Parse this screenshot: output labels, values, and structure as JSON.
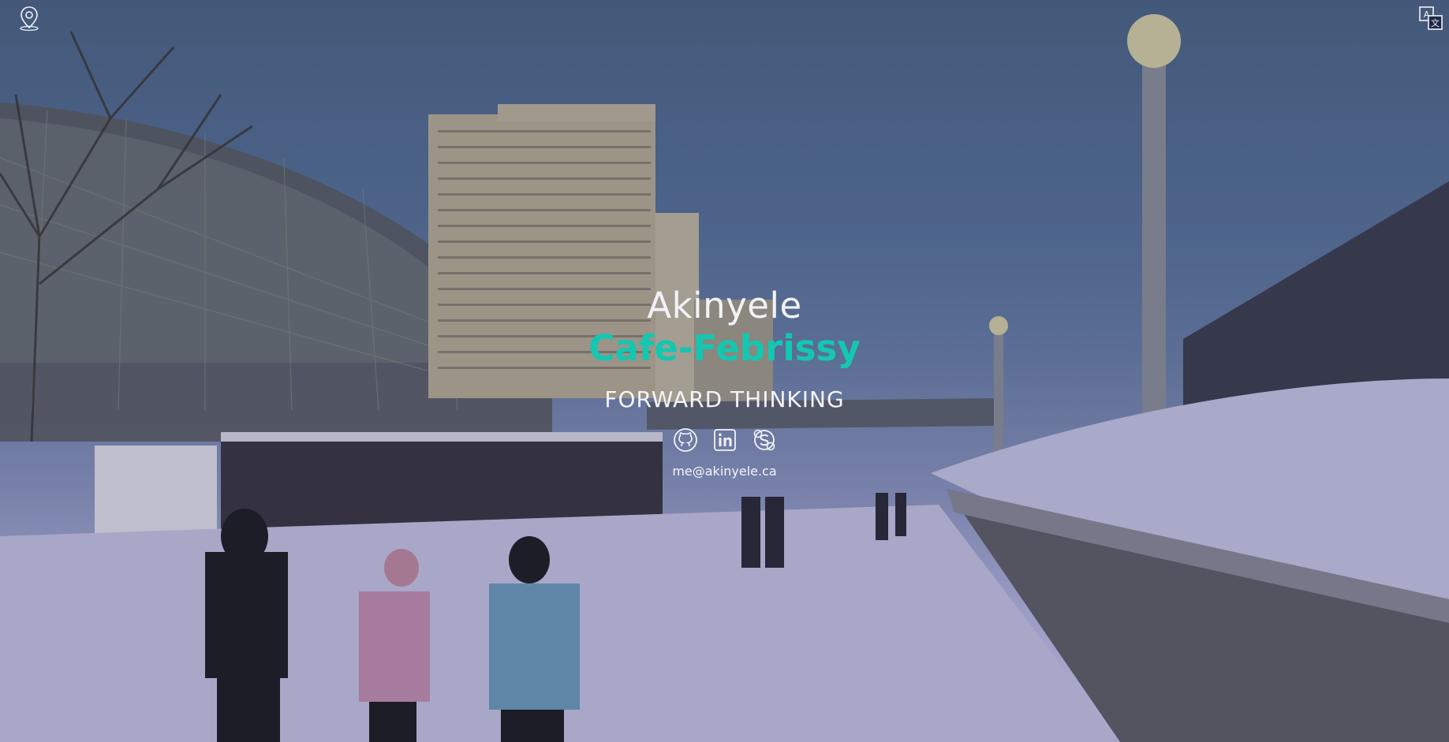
{
  "header": {
    "location_icon": "map-pin-icon",
    "translate_icon": "translate-icon"
  },
  "hero": {
    "first_name": "Akinyele",
    "last_name": "Cafe-Febrissy",
    "tagline": "FORWARD THINKING",
    "email": "me@akinyele.ca"
  },
  "socials": [
    {
      "name": "github-icon"
    },
    {
      "name": "linkedin-icon"
    },
    {
      "name": "skype-icon"
    }
  ],
  "colors": {
    "accent": "#13c7b1",
    "text": "#f2f2f6",
    "overlay": "#1e2846"
  }
}
